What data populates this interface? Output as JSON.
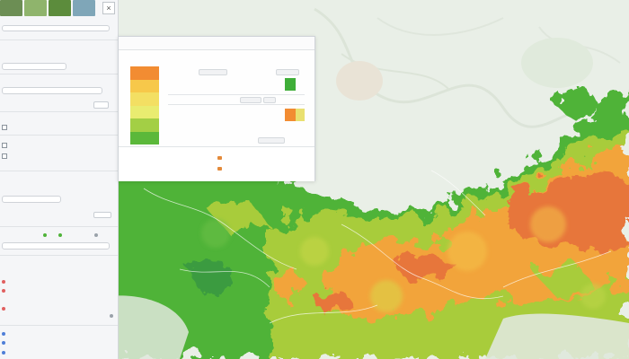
{
  "window": {
    "title": ""
  },
  "map": {
    "palette": {
      "background": "#e8ede8",
      "low_vegetation": "#4fb339",
      "mid_vegetation": "#a8cc3a",
      "high_index": "#f2a43a",
      "peak_index": "#e7763a",
      "river": "#ffffff"
    }
  },
  "sidebar": {
    "close_icon": "×",
    "sections": [
      {
        "name": "layer-settings",
        "title": "",
        "items": []
      },
      {
        "name": "filters",
        "title": "",
        "items": []
      },
      {
        "name": "statistics",
        "title": "",
        "items": []
      }
    ]
  },
  "legend_popup": {
    "tabs": [
      "",
      "",
      "",
      ""
    ],
    "swatches": [
      "#f28c32",
      "#f7c84a",
      "#f3df63",
      "#e9ec70",
      "#a3cf45",
      "#5bb83a"
    ],
    "rows": [
      {
        "label": ""
      },
      {
        "label": ""
      },
      {
        "label": ""
      },
      {
        "label": ""
      },
      {
        "label": ""
      }
    ],
    "mini_bars": [
      "#3fae38",
      "#f28c32",
      "#e9e070"
    ]
  }
}
